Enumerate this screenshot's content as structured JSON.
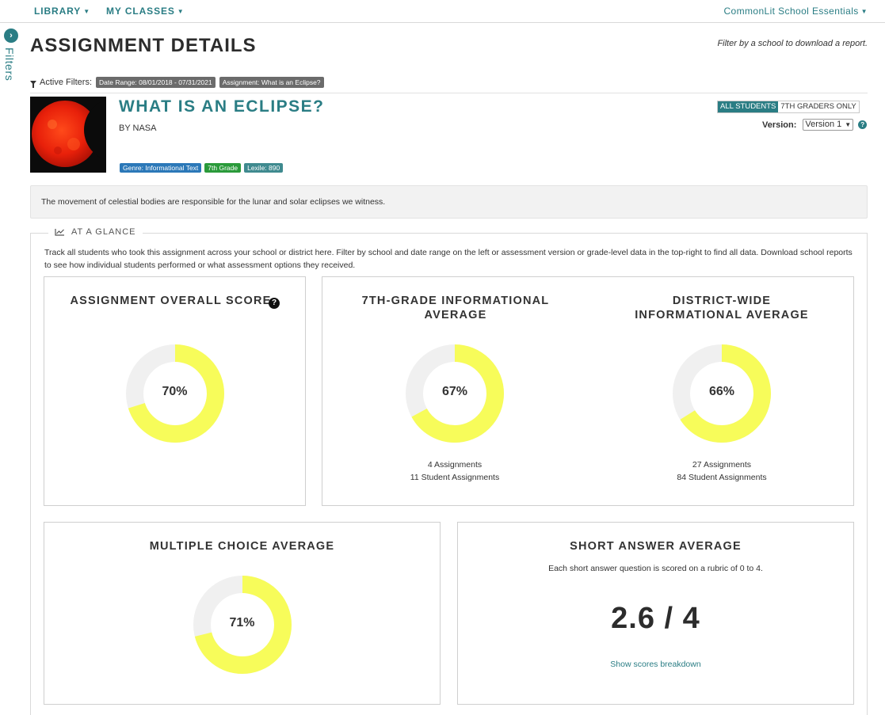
{
  "nav": {
    "library": "LIBRARY",
    "my_classes": "MY CLASSES",
    "account": "CommonLit School Essentials"
  },
  "filters_tab": {
    "label": "Filters"
  },
  "page": {
    "title": "ASSIGNMENT DETAILS",
    "filter_note": "Filter by a school to download a report."
  },
  "active_filters": {
    "label": "Active Filters:",
    "chips": [
      "Date Range:  08/01/2018 - 07/31/2021",
      "Assignment:  What is an Eclipse?"
    ]
  },
  "text": {
    "title": "WHAT IS AN ECLIPSE?",
    "author": "BY NASA",
    "tags": [
      "Genre: Informational Text",
      "7th Grade",
      "Lexile: 890"
    ],
    "summary": "The movement of celestial bodies are responsible for the lunar and solar eclipses we witness."
  },
  "toggle": {
    "all_students": "ALL STUDENTS",
    "seventh_only": "7TH GRADERS ONLY",
    "selected": "all_students"
  },
  "version": {
    "label": "Version:",
    "selected": "Version 1"
  },
  "glance": {
    "title": "AT A GLANCE",
    "description": "Track all students who took this assignment across your school or district here. Filter by school and date range on the left or assessment version or grade-level data in the top-right to find all data. Download school reports to see how individual students performed or what assessment options they received."
  },
  "cards": {
    "overall": {
      "title": "ASSIGNMENT OVERALL SCORE",
      "percent_label": "70%",
      "value": 0.7
    },
    "grade_avg": {
      "title": "7TH-GRADE INFORMATIONAL AVERAGE",
      "percent_label": "67%",
      "value": 0.67,
      "assignments": "4 Assignments",
      "student_assignments": "11 Student Assignments"
    },
    "district_avg": {
      "title": "DISTRICT-WIDE INFORMATIONAL AVERAGE",
      "percent_label": "66%",
      "value": 0.66,
      "assignments": "27 Assignments",
      "student_assignments": "84 Student Assignments"
    },
    "multiple_choice": {
      "title": "MULTIPLE CHOICE AVERAGE",
      "percent_label": "71%",
      "value": 0.71
    },
    "short_answer": {
      "title": "SHORT ANSWER AVERAGE",
      "rubric_note": "Each short answer question is scored on a rubric of 0 to 4.",
      "score": "2.6 / 4",
      "link": "Show scores breakdown"
    }
  },
  "colors": {
    "brand": "#2a7d84",
    "donut_fill": "#f7fc5a",
    "donut_track": "#f0f0f0"
  }
}
